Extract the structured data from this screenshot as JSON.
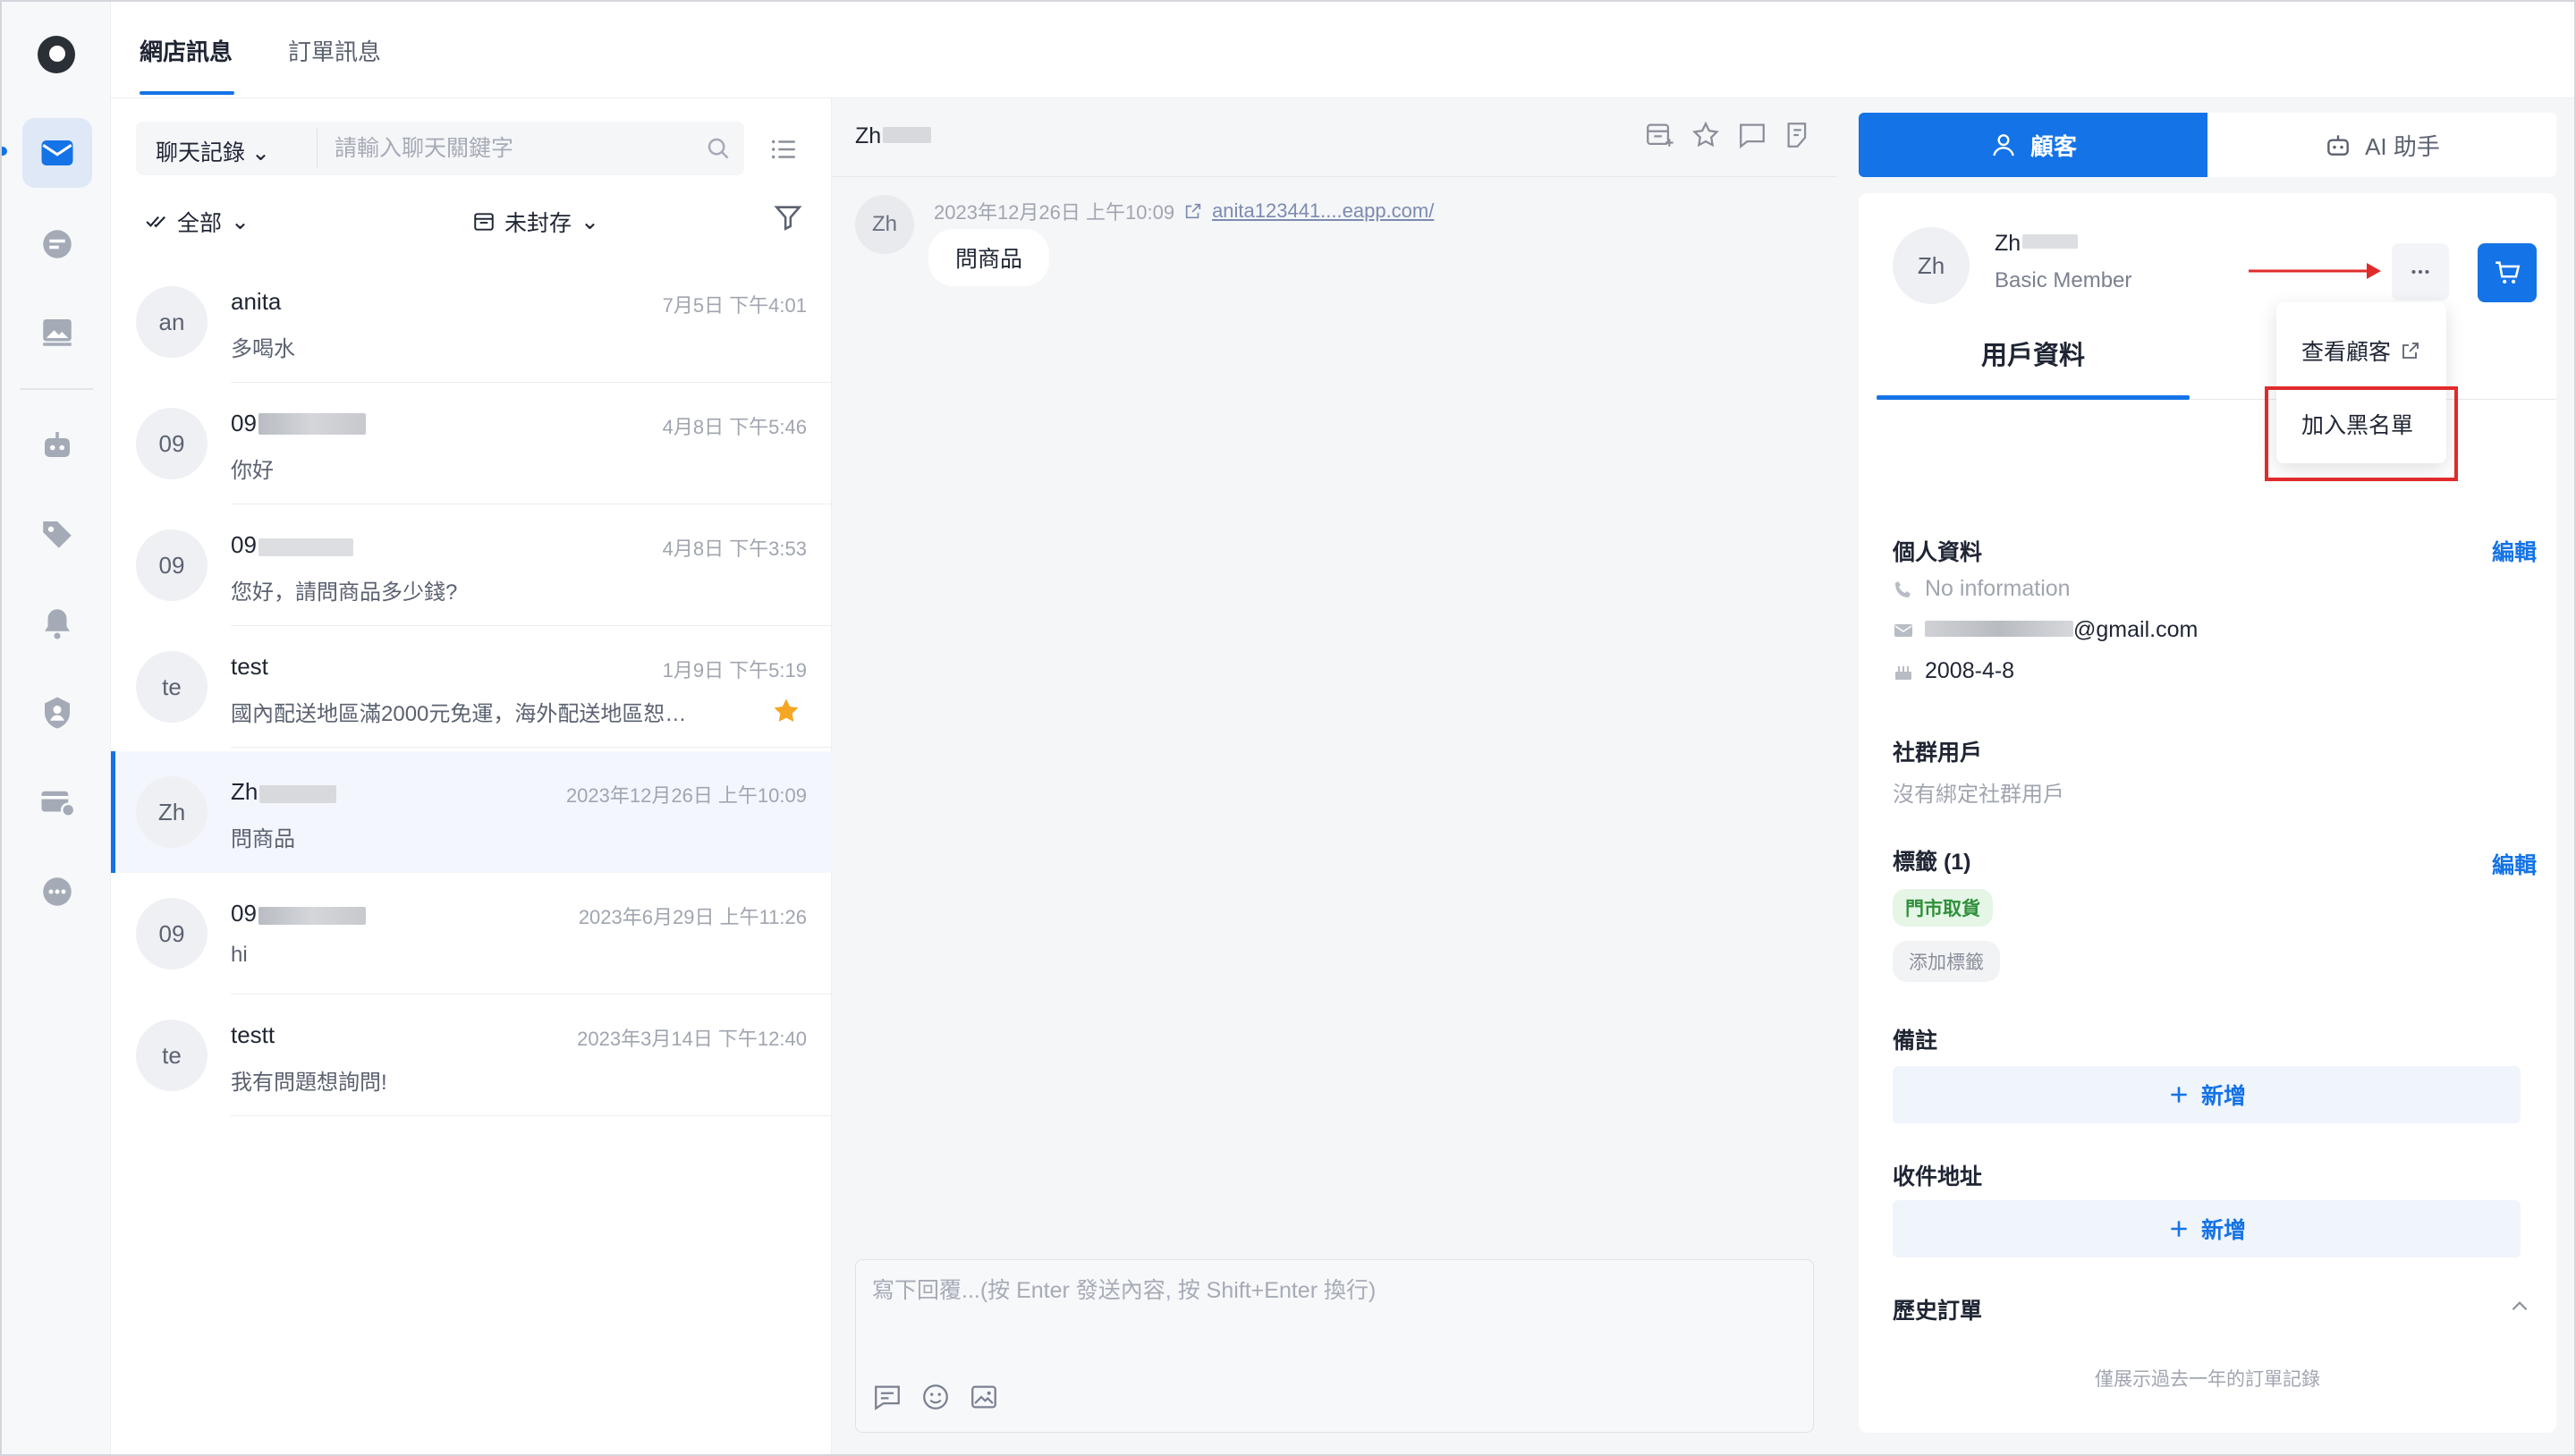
{
  "top_tabs": [
    "網店訊息",
    "訂單訊息"
  ],
  "search": {
    "type_label": "聊天記錄",
    "placeholder": "請輸入聊天關鍵字"
  },
  "filters": {
    "all_label": "全部",
    "archive_label": "未封存"
  },
  "conversations": [
    {
      "avatar": "an",
      "name": "anita",
      "time": "7月5日 下午4:01",
      "message": "多喝水"
    },
    {
      "avatar": "09",
      "name": "09",
      "time": "4月8日 下午5:46",
      "message": "你好"
    },
    {
      "avatar": "09",
      "name": "09",
      "time": "4月8日 下午3:53",
      "message": "您好，請問商品多少錢?"
    },
    {
      "avatar": "te",
      "name": "test",
      "time": "1月9日 下午5:19",
      "message": "國內配送地區滿2000元免運，海外配送地區恕…"
    },
    {
      "avatar": "Zh",
      "name": "Zh",
      "time": "2023年12月26日 上午10:09",
      "message": "問商品"
    },
    {
      "avatar": "09",
      "name": "09",
      "time": "2023年6月29日 上午11:26",
      "message": "hi"
    },
    {
      "avatar": "te",
      "name": "testt",
      "time": "2023年3月14日 下午12:40",
      "message": "我有問題想詢問!"
    }
  ],
  "chat": {
    "title": "Zh",
    "avatar": "Zh",
    "message_time": "2023年12月26日 上午10:09",
    "message_link": "anita123441....eapp.com/",
    "message_text": "問商品",
    "composer_placeholder": "寫下回覆...(按 Enter 發送內容, 按 Shift+Enter 換行)"
  },
  "panel": {
    "tab_customer": "顧客",
    "tab_ai": "AI 助手",
    "customer_avatar": "Zh",
    "customer_name": "Zh",
    "customer_level": "Basic Member",
    "subtab": "用戶資料",
    "personal_title": "個人資料",
    "edit_label": "編輯",
    "phone": "No information",
    "email_suffix": "@gmail.com",
    "birthday": "2008-4-8",
    "social_title": "社群用戶",
    "social_empty": "沒有綁定社群用戶",
    "tags_title": "標籤 (1)",
    "tag_1": "門市取貨",
    "tag_add": "添加標籤",
    "notes_title": "備註",
    "add_label": "新增",
    "address_title": "收件地址",
    "history_title": "歷史訂單",
    "history_note": "僅展示過去一年的訂單記錄"
  },
  "menu": {
    "view_customer": "查看顧客",
    "add_blacklist": "加入黑名單"
  },
  "colors": {
    "accent": "#1473e6",
    "highlight": "#e02b2b",
    "tag_green": "#2f8f3a",
    "star": "#f5a623"
  }
}
